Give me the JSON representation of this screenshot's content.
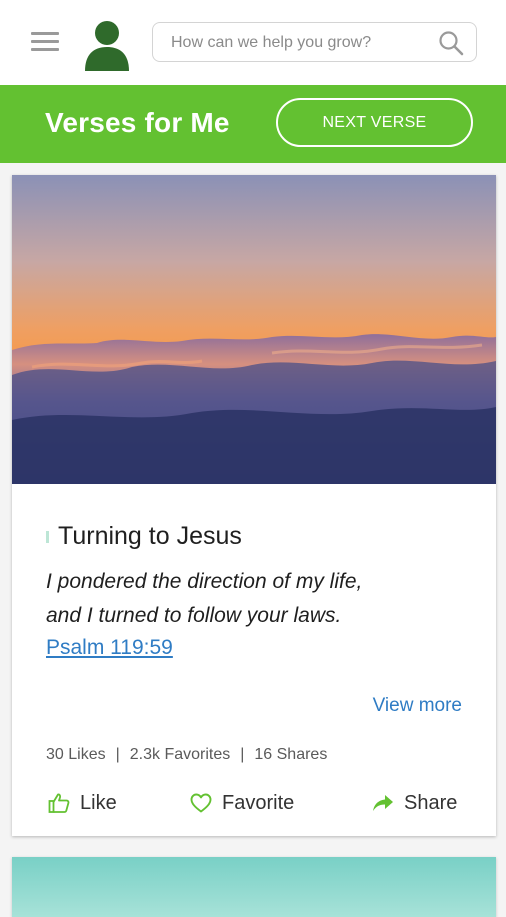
{
  "header": {
    "search_placeholder": "How can we help you grow?"
  },
  "banner": {
    "title": "Verses for Me",
    "next_button": "NEXT VERSE"
  },
  "verse_card": {
    "title": "Turning to Jesus",
    "verse_line_1": "I pondered the direction of my life,",
    "verse_line_2": "and I turned to follow your laws.",
    "reference": "Psalm 119:59",
    "view_more": "View more",
    "stats": {
      "likes": "30 Likes",
      "favorites": "2.3k Favorites",
      "shares": "16 Shares",
      "separator": "|"
    },
    "actions": {
      "like": "Like",
      "favorite": "Favorite",
      "share": "Share"
    }
  },
  "colors": {
    "brand_green": "#63c131",
    "avatar_green": "#2f6a2b",
    "link_blue": "#2f7cc4"
  },
  "icons": [
    "menu-icon",
    "user-avatar-icon",
    "search-icon",
    "thumbs-up-icon",
    "heart-icon",
    "share-arrow-icon"
  ]
}
